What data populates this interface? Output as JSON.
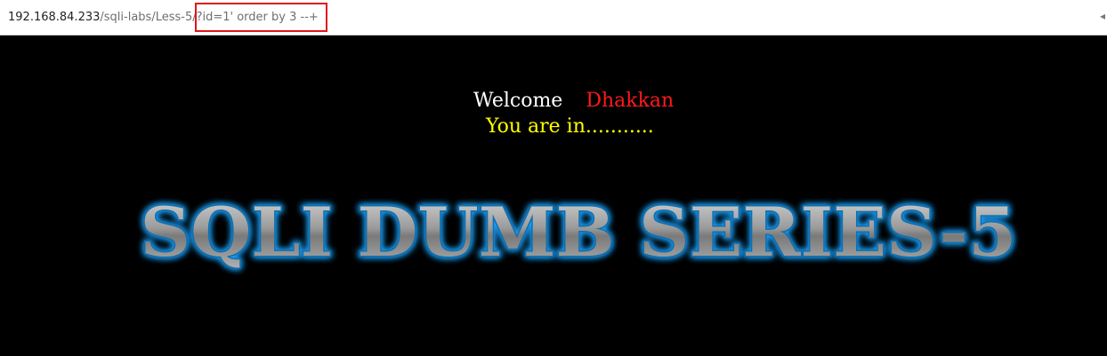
{
  "browser": {
    "url_host": "192.168.84.233",
    "url_path": "/sqli-labs/Less-5/",
    "url_query": "?id=1' order by 3 --+"
  },
  "page": {
    "welcome_text": "Welcome",
    "user_name": "Dhakkan",
    "status_text": "You are in...........",
    "banner_title": "SQLI DUMB SERIES-5"
  },
  "colors": {
    "background": "#000000",
    "welcome": "#ffffff",
    "user_name": "#ff1a1a",
    "status": "#ffff00",
    "highlight": "#e0161b",
    "banner_glow": "#1fa3ff"
  }
}
